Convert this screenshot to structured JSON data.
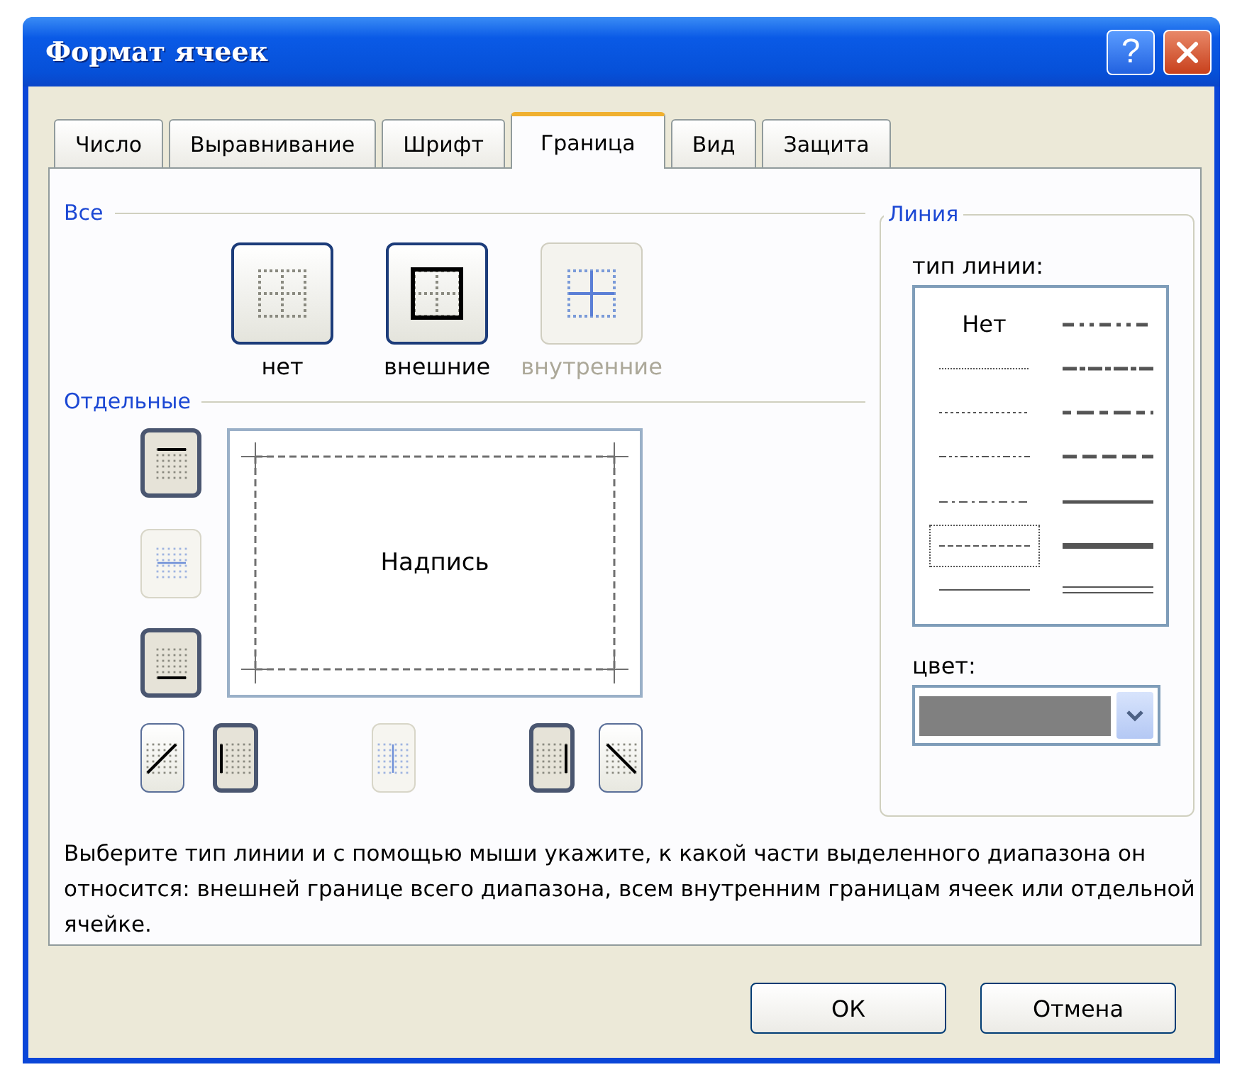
{
  "window": {
    "title": "Формат ячеек",
    "help_button": "?"
  },
  "tabs": [
    {
      "label": "Число",
      "selected": false
    },
    {
      "label": "Выравнивание",
      "selected": false
    },
    {
      "label": "Шрифт",
      "selected": false
    },
    {
      "label": "Граница",
      "selected": true
    },
    {
      "label": "Вид",
      "selected": false
    },
    {
      "label": "Защита",
      "selected": false
    }
  ],
  "presets": {
    "title": "Все",
    "items": [
      {
        "kind": "none",
        "label": "нет",
        "disabled": false
      },
      {
        "kind": "outline",
        "label": "внешние",
        "disabled": false
      },
      {
        "kind": "inside",
        "label": "внутренние",
        "disabled": true
      }
    ]
  },
  "borders": {
    "title": "Отдельные",
    "preview_text": "Надпись",
    "buttons": [
      {
        "kind": "top",
        "pressed": true,
        "disabled": false
      },
      {
        "kind": "middle-h",
        "pressed": false,
        "disabled": true
      },
      {
        "kind": "bottom",
        "pressed": true,
        "disabled": false
      },
      {
        "kind": "diag-up",
        "pressed": false,
        "disabled": false
      },
      {
        "kind": "left",
        "pressed": true,
        "disabled": false
      },
      {
        "kind": "middle-v",
        "pressed": false,
        "disabled": true
      },
      {
        "kind": "right",
        "pressed": true,
        "disabled": false
      },
      {
        "kind": "diag-down",
        "pressed": false,
        "disabled": false
      }
    ]
  },
  "line": {
    "title": "Линия",
    "style_label": "тип линии:",
    "styles": [
      {
        "kind": "none",
        "label": "Нет",
        "selected": false
      },
      {
        "kind": "hair",
        "selected": false
      },
      {
        "kind": "dotted",
        "selected": false
      },
      {
        "kind": "dash-dot-dot",
        "selected": false
      },
      {
        "kind": "dash-dot",
        "selected": false
      },
      {
        "kind": "dashed",
        "selected": true
      },
      {
        "kind": "thin",
        "selected": false
      },
      {
        "kind": "medium-dash-dot-dot",
        "selected": false
      },
      {
        "kind": "slant-dash-dot",
        "selected": false
      },
      {
        "kind": "medium-dash-dot",
        "selected": false
      },
      {
        "kind": "medium-dashed",
        "selected": false
      },
      {
        "kind": "medium",
        "selected": false
      },
      {
        "kind": "thick",
        "selected": false
      },
      {
        "kind": "double",
        "selected": false
      }
    ],
    "color_label": "цвет:",
    "color": "#808080"
  },
  "description": "Выберите тип линии и с помощью мыши укажите, к какой части выделенного диапазона он относится: внешней границе всего диапазона, всем внутренним границам ячеек или отдельной ячейке.",
  "buttons": [
    {
      "label": "ОК"
    },
    {
      "label": "Отмена"
    }
  ]
}
